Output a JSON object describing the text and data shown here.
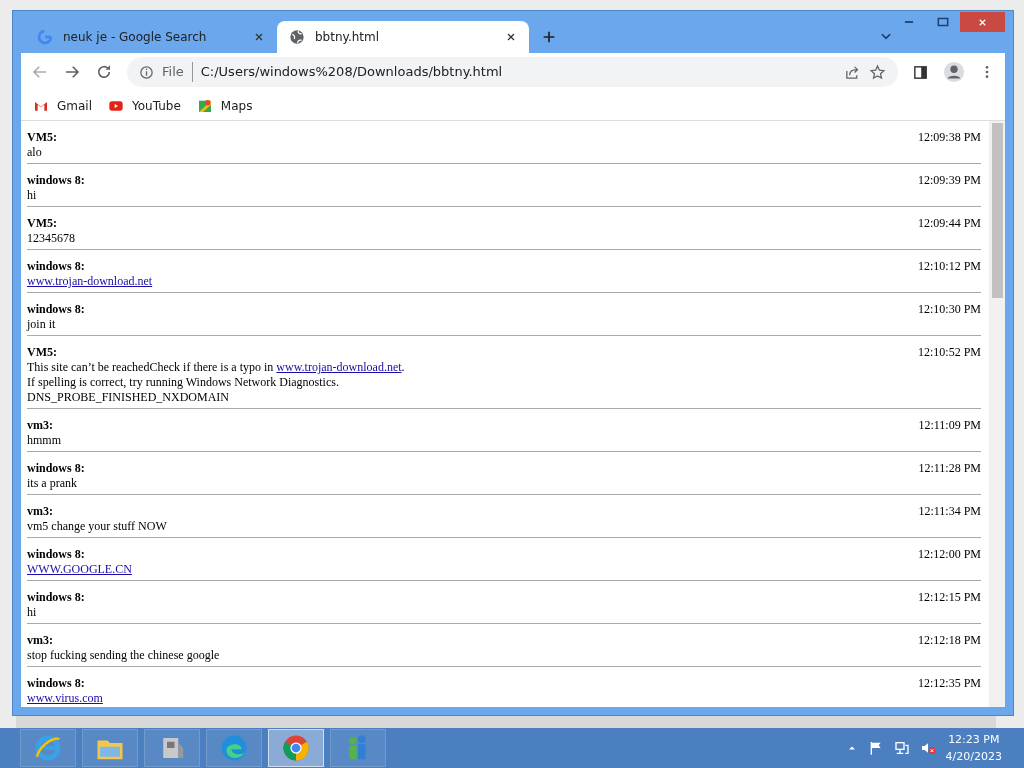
{
  "browser": {
    "tabs": [
      {
        "title": "neuk je - Google Search",
        "selected": false
      },
      {
        "title": "bbtny.html",
        "selected": true
      }
    ],
    "address": {
      "scheme": "File",
      "url": "C:/Users/windows%208/Downloads/bbtny.html"
    },
    "bookmarks": [
      {
        "label": "Gmail"
      },
      {
        "label": "YouTube"
      },
      {
        "label": "Maps"
      }
    ]
  },
  "messages": [
    {
      "sender": "VM5:",
      "time": "12:09:38 PM",
      "lines": [
        [
          {
            "kind": "text",
            "text": "alo"
          }
        ]
      ]
    },
    {
      "sender": "windows 8:",
      "time": "12:09:39 PM",
      "lines": [
        [
          {
            "kind": "text",
            "text": "hi"
          }
        ]
      ]
    },
    {
      "sender": "VM5:",
      "time": "12:09:44 PM",
      "lines": [
        [
          {
            "kind": "text",
            "text": "12345678"
          }
        ]
      ]
    },
    {
      "sender": "windows 8:",
      "time": "12:10:12 PM",
      "lines": [
        [
          {
            "kind": "link",
            "text": "www.trojan-download.net"
          }
        ]
      ]
    },
    {
      "sender": "windows 8:",
      "time": "12:10:30 PM",
      "lines": [
        [
          {
            "kind": "text",
            "text": "join it"
          }
        ]
      ]
    },
    {
      "sender": "VM5:",
      "time": "12:10:52 PM",
      "lines": [
        [
          {
            "kind": "text",
            "text": "This site can’t be reachedCheck if there is a typo in "
          },
          {
            "kind": "link",
            "text": "www.trojan-download.net"
          },
          {
            "kind": "text",
            "text": "."
          }
        ],
        [
          {
            "kind": "text",
            "text": "If spelling is correct, try running Windows Network Diagnostics."
          }
        ],
        [
          {
            "kind": "text",
            "text": "DNS_PROBE_FINISHED_NXDOMAIN"
          }
        ]
      ]
    },
    {
      "sender": "vm3:",
      "time": "12:11:09 PM",
      "lines": [
        [
          {
            "kind": "text",
            "text": "hmmm"
          }
        ]
      ]
    },
    {
      "sender": "windows 8:",
      "time": "12:11:28 PM",
      "lines": [
        [
          {
            "kind": "text",
            "text": "its a prank"
          }
        ]
      ]
    },
    {
      "sender": "vm3:",
      "time": "12:11:34 PM",
      "lines": [
        [
          {
            "kind": "text",
            "text": "vm5 change your stuff NOW"
          }
        ]
      ]
    },
    {
      "sender": "windows 8:",
      "time": "12:12:00 PM",
      "lines": [
        [
          {
            "kind": "link",
            "text": "WWW.GOOGLE.CN"
          }
        ]
      ]
    },
    {
      "sender": "windows 8:",
      "time": "12:12:15 PM",
      "lines": [
        [
          {
            "kind": "text",
            "text": "hi"
          }
        ]
      ]
    },
    {
      "sender": "vm3:",
      "time": "12:12:18 PM",
      "lines": [
        [
          {
            "kind": "text",
            "text": "stop fucking sending the chinese google"
          }
        ]
      ]
    },
    {
      "sender": "windows 8:",
      "time": "12:12:35 PM",
      "lines": [
        [
          {
            "kind": "link",
            "text": "www.virus.com"
          }
        ]
      ]
    }
  ],
  "taskbar": {
    "apps": [
      {
        "selected": false
      },
      {
        "selected": false
      },
      {
        "selected": false
      },
      {
        "selected": false
      },
      {
        "selected": true
      },
      {
        "selected": false
      }
    ],
    "clock": {
      "time": "12:23 PM",
      "date": "4/20/2023"
    }
  }
}
